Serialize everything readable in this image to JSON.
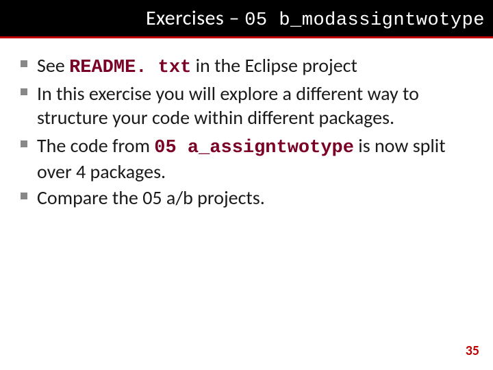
{
  "title": {
    "prefix": "Exercises – ",
    "code": "05 b_modassigntwotype"
  },
  "bullets": [
    {
      "pre": "See ",
      "code": "README. txt",
      "post": " in the Eclipse project"
    },
    {
      "pre": "In this exercise you will explore a different way to structure your code within different packages.",
      "code": "",
      "post": ""
    },
    {
      "pre": "The code from ",
      "code": "05 a_assigntwotype",
      "post": " is now split over 4 packages."
    },
    {
      "pre": "Compare the 05 a/b projects.",
      "code": "",
      "post": ""
    }
  ],
  "pageNumber": "35"
}
